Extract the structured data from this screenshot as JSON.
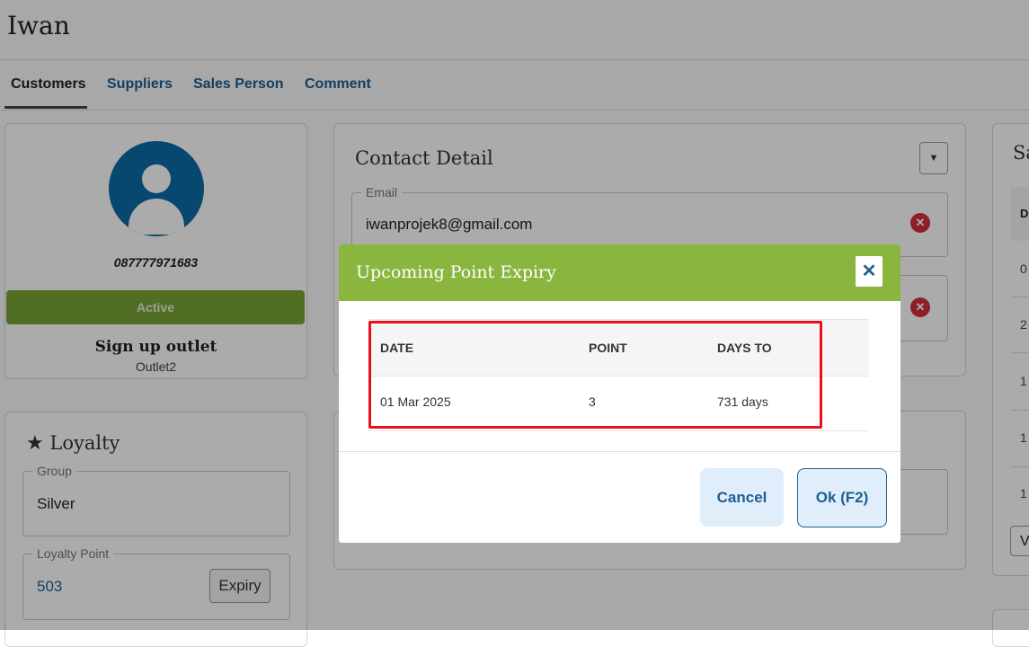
{
  "header": {
    "title": "Iwan"
  },
  "tabs": [
    {
      "label": "Customers",
      "active": true
    },
    {
      "label": "Suppliers",
      "active": false
    },
    {
      "label": "Sales Person",
      "active": false
    },
    {
      "label": "Comment",
      "active": false
    }
  ],
  "profile": {
    "phone": "087777971683",
    "status": "Active",
    "signup_outlet_label": "Sign up outlet",
    "signup_outlet_value": "Outlet2"
  },
  "loyalty": {
    "title": "Loyalty",
    "group_label": "Group",
    "group_value": "Silver",
    "point_label": "Loyalty Point",
    "point_value": "503",
    "expiry_button": "Expiry"
  },
  "contact": {
    "title": "Contact Detail",
    "email_label": "Email",
    "email_value": "iwanprojek8@gmail.com"
  },
  "right_panel": {
    "title_partial": "Sa",
    "header_partial": "D",
    "rows": [
      "0",
      "2",
      "1",
      "1",
      "1"
    ],
    "button_partial": "V"
  },
  "modal": {
    "title": "Upcoming Point Expiry",
    "columns": [
      "DATE",
      "POINT",
      "DAYS TO"
    ],
    "rows": [
      {
        "date": "01 Mar 2025",
        "point": "3",
        "days": "731 days"
      }
    ],
    "cancel_label": "Cancel",
    "ok_label": "Ok (F2)"
  },
  "colors": {
    "modal_header": "#8ab53f",
    "primary_text": "#1f5f91",
    "highlight": "#e8101c",
    "status_active": "#79a637"
  }
}
